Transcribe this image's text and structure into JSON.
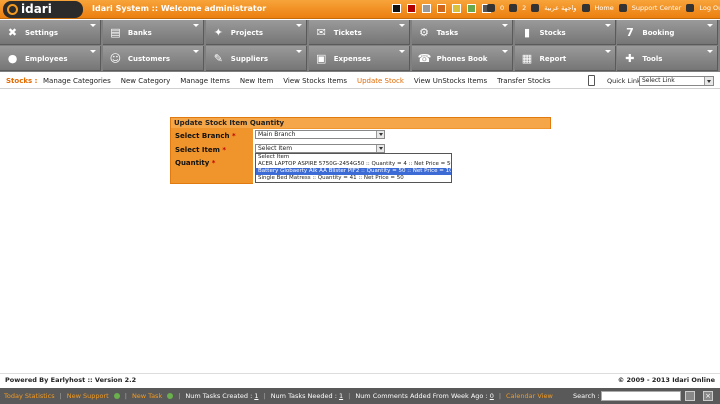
{
  "header": {
    "logo_text": "idari",
    "title": "Idari System :: Welcome administrator",
    "swatch_colors": [
      "#111111",
      "#b00000",
      "#9a9a9a",
      "#d1671a",
      "#d9c23a",
      "#6aa84f",
      "#555555"
    ],
    "mail_count": "0",
    "attach_count": "2",
    "language": "واجهة عربية",
    "home": "Home",
    "support": "Support Center",
    "logout": "Log Out"
  },
  "menu": {
    "items": [
      {
        "label": "Settings",
        "icon": "✖"
      },
      {
        "label": "Banks",
        "icon": "▤"
      },
      {
        "label": "Projects",
        "icon": "✦"
      },
      {
        "label": "Tickets",
        "icon": "✉"
      },
      {
        "label": "Tasks",
        "icon": "⚙"
      },
      {
        "label": "Stocks",
        "icon": "▮"
      },
      {
        "label": "Booking",
        "icon": "7"
      },
      {
        "label": "Employees",
        "icon": "●"
      },
      {
        "label": "Customers",
        "icon": "☺"
      },
      {
        "label": "Suppliers",
        "icon": "✎"
      },
      {
        "label": "Expenses",
        "icon": "▣"
      },
      {
        "label": "Phones Book",
        "icon": "☎"
      },
      {
        "label": "Report",
        "icon": "▦"
      },
      {
        "label": "Tools",
        "icon": "✚"
      }
    ]
  },
  "subnav": {
    "title": "Stocks :",
    "links": [
      "Manage Categories",
      "New Category",
      "Manage Items",
      "New Item",
      "View Stocks Items",
      "Update Stock",
      "View UnStocks Items",
      "Transfer Stocks"
    ],
    "active_index": 5,
    "quick_link_label": "Quick Link",
    "quick_link_value": "Select Link"
  },
  "form": {
    "title": "Update Stock Item Quantity",
    "branch_label": "Select Branch",
    "item_label": "Select Item",
    "quantity_label": "Quantity",
    "required_mark": "*",
    "branch_value": "Main Branch",
    "item_value": "Select Item",
    "item_options": [
      "Select Item",
      "ACER LAPTOP ASPIRE 5750G-2454G50 :: Quantity = 4 :: Net Price = 500",
      "Battery Globaerty Alk AA Blister PIF2 :: Quantity = 50 :: Net Price = 10",
      "Single Bed Matress :: Quantity = 41 :: Net Price = 50"
    ],
    "highlighted_option": 2
  },
  "footer": {
    "powered": "Powered By Earlyhost :: Version 2.2",
    "copyright": "© 2009 - 2013 Idari Online"
  },
  "statusbar": {
    "items": [
      {
        "text": "Today Statistics",
        "style": "orange"
      },
      {
        "text": "New Support",
        "style": "orange"
      },
      {
        "text": "New Task",
        "style": "orange"
      },
      {
        "text": "Num Tasks Created : ",
        "count": "1"
      },
      {
        "text": "Num Tasks Needed : ",
        "count": "1"
      },
      {
        "text": "Num Comments Added From Week Ago : ",
        "count": "0"
      },
      {
        "text": "Calendar View",
        "style": "orange"
      }
    ],
    "search_label": "Search :"
  }
}
